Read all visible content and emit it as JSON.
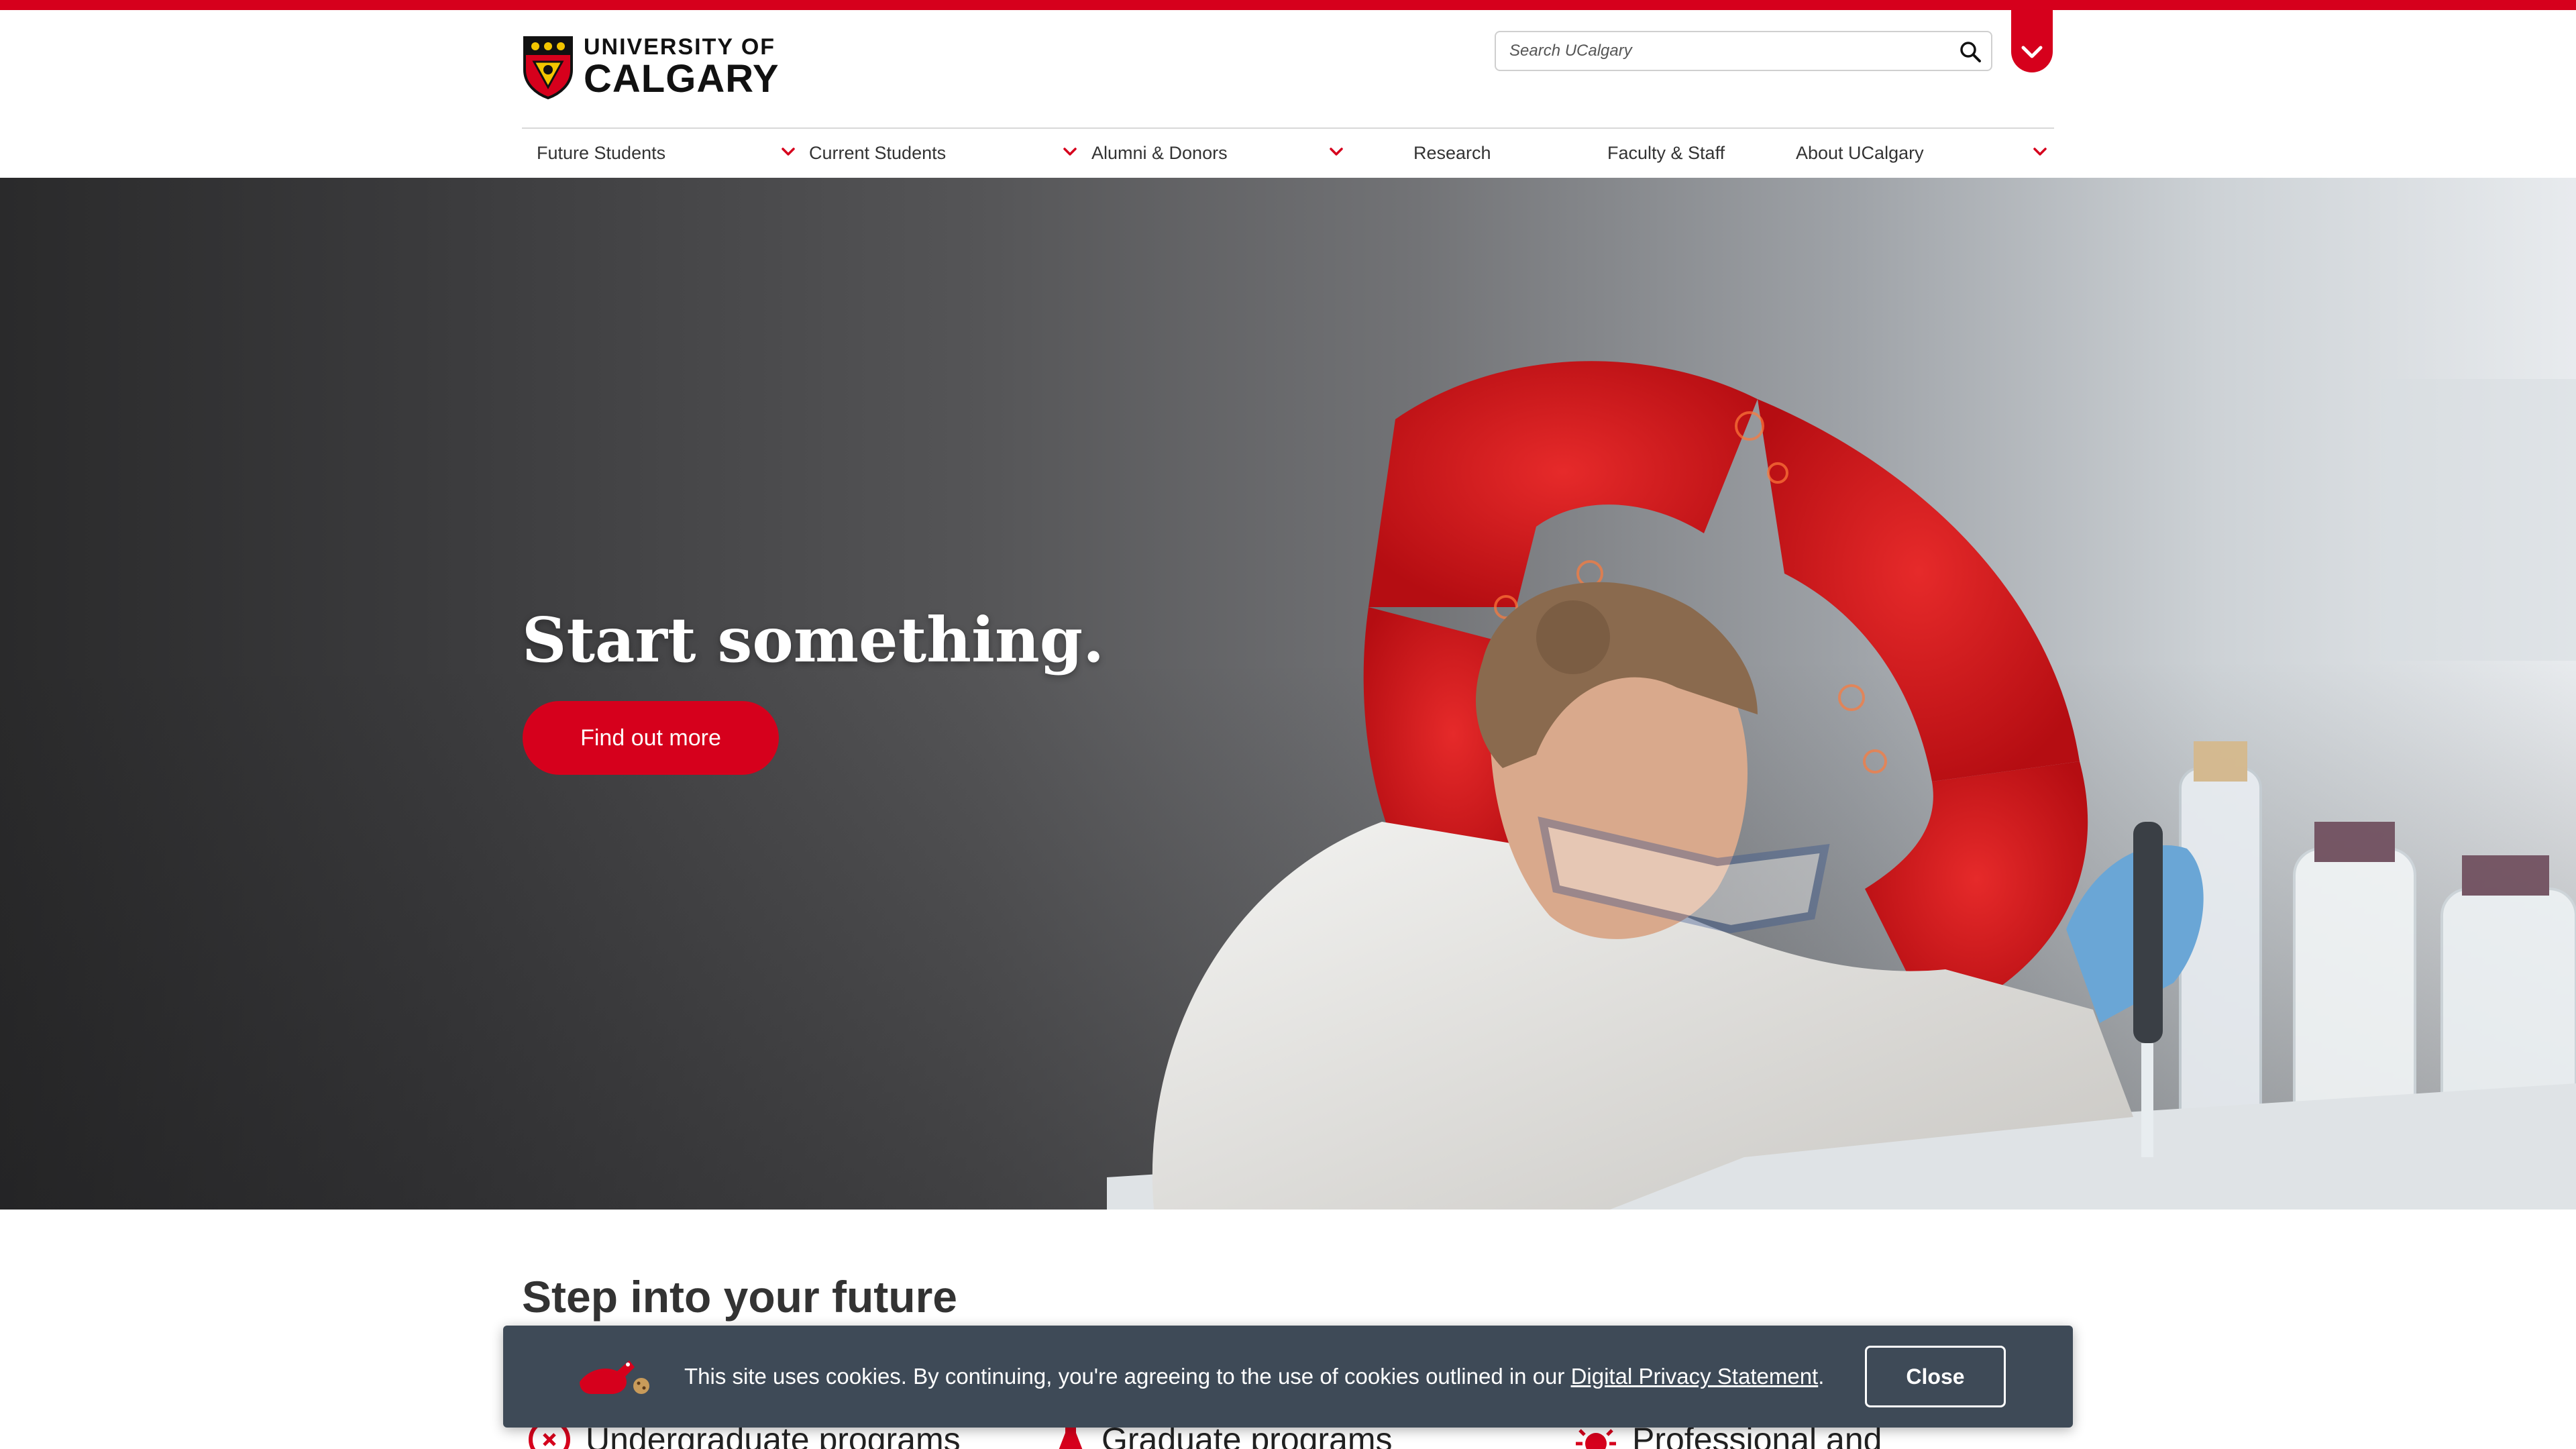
{
  "colors": {
    "brand_red": "#d6001c",
    "text_dark": "#333333",
    "banner_bg": "#3e4a57"
  },
  "header": {
    "logo": {
      "line1": "UNIVERSITY OF",
      "line2": "CALGARY",
      "icon": "university-crest-icon"
    },
    "search": {
      "placeholder": "Search UCalgary",
      "icon": "search-icon"
    },
    "utility_toggle_icon": "chevron-down-icon"
  },
  "nav": {
    "items": [
      {
        "label": "Future Students",
        "has_dropdown": true
      },
      {
        "label": "Current Students",
        "has_dropdown": true
      },
      {
        "label": "Alumni & Donors",
        "has_dropdown": true
      },
      {
        "label": "Research",
        "has_dropdown": false
      },
      {
        "label": "Faculty & Staff",
        "has_dropdown": false
      },
      {
        "label": "About UCalgary",
        "has_dropdown": true
      }
    ]
  },
  "hero": {
    "title": "Start something.",
    "cta_label": "Find out more"
  },
  "main": {
    "section_title": "Step into your future",
    "programs": [
      {
        "label": "Undergraduate programs",
        "icon": "compass-icon"
      },
      {
        "label": "Graduate programs",
        "icon": "flask-icon"
      },
      {
        "label": "Professional and",
        "icon": "sun-icon"
      }
    ]
  },
  "cookie_banner": {
    "message_before": "This site uses cookies. By continuing, you're agreeing to the use of cookies outlined in our ",
    "link_text": "Digital Privacy Statement",
    "message_after": ".",
    "close_label": "Close",
    "mascot_icon": "dino-cookie-mascot-icon"
  }
}
